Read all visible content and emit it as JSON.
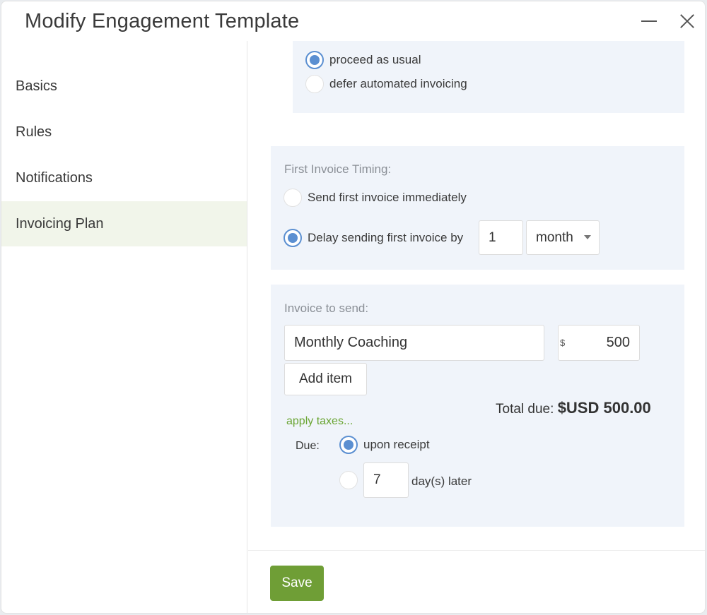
{
  "dialog": {
    "title": "Modify Engagement Template",
    "minimize_icon": "minimize-icon",
    "close_icon": "close-icon"
  },
  "sidebar": {
    "items": [
      {
        "label": "Basics",
        "active": false
      },
      {
        "label": "Rules",
        "active": false
      },
      {
        "label": "Notifications",
        "active": false
      },
      {
        "label": "Invoicing Plan",
        "active": true
      }
    ]
  },
  "top_options": {
    "options": [
      {
        "label": "proceed as usual",
        "checked": true
      },
      {
        "label": "defer automated invoicing",
        "checked": false
      }
    ]
  },
  "first_invoice_timing": {
    "label": "First Invoice Timing:",
    "immediately_label": "Send first invoice immediately",
    "immediately_checked": false,
    "delay_label": "Delay sending first invoice by",
    "delay_checked": true,
    "delay_amount": "1",
    "delay_unit": "month"
  },
  "invoice": {
    "label": "Invoice to send:",
    "item_name": "Monthly Coaching",
    "currency_symbol": "$",
    "amount": "500",
    "add_item_label": "Add item",
    "total_label": "Total due:",
    "total_value": "$USD 500.00",
    "apply_taxes_label": "apply taxes...",
    "due_label": "Due:",
    "upon_receipt_label": "upon receipt",
    "upon_receipt_checked": true,
    "days_later_value": "7",
    "days_later_label": "day(s) later",
    "days_later_checked": false
  },
  "footer": {
    "save_label": "Save"
  },
  "colors": {
    "accent_green": "#6f9e36",
    "radio_blue": "#5b8fd1",
    "panel_bg": "#f0f4fa",
    "active_nav_bg": "#f1f5ea"
  }
}
